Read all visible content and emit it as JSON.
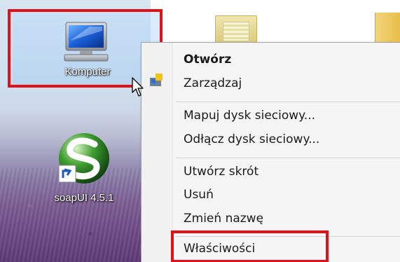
{
  "desktop": {
    "icons": [
      {
        "id": "komputer",
        "label": "Komputer",
        "icon": "computer-monitor-icon"
      },
      {
        "id": "soapui",
        "label": "soapUI 4.5.1",
        "icon": "soapui-shortcut-icon"
      }
    ]
  },
  "context_menu": {
    "items": [
      {
        "label": "Otwórz",
        "bold": true
      },
      {
        "label": "Zarządzaj"
      },
      {
        "label": "Mapuj dysk sieciowy..."
      },
      {
        "label": "Odłącz dysk sieciowy..."
      },
      {
        "label": "Utwórz skrót"
      },
      {
        "label": "Usuń"
      },
      {
        "label": "Zmień nazwę"
      },
      {
        "label": "Właściwości"
      }
    ]
  },
  "colors": {
    "highlight_border": "#e3101a",
    "menu_background": "#f5f5f5"
  }
}
